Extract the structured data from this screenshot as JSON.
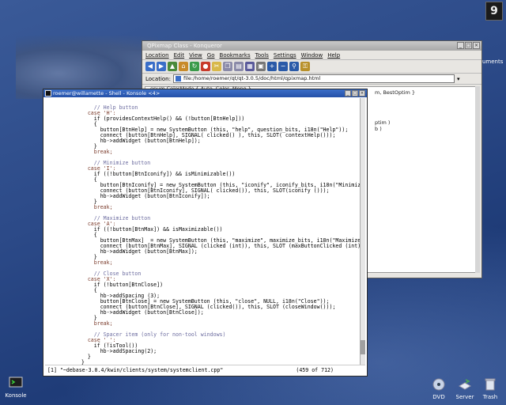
{
  "desktop": {
    "logo_text": "9",
    "icons": {
      "konsole": "Konsole",
      "dvd": "DVD",
      "server": "Server",
      "trash": "Trash",
      "edge": "uments"
    }
  },
  "konqueror": {
    "title": "QPixmap Class - Konqueror",
    "menu": [
      "Location",
      "Edit",
      "View",
      "Go",
      "Bookmarks",
      "Tools",
      "Settings",
      "Window",
      "Help"
    ],
    "location_label": "Location:",
    "location_value": "file:/home/roemer/qt/qt-3.0.5/doc/html/qpixmap.html",
    "content_lines": [
      "enum ColorMode { Auto, Color, Mono }",
      "m, BestOptim }",
      "ptim )",
      "b )"
    ]
  },
  "konsole": {
    "title": "roemer@willamette - Shell - Konsole <4>",
    "lines": [
      "        // Help button",
      "      case 'H':",
      "        if (providesContextHelp() && (!button[BtnHelp]))",
      "        {",
      "          button[BtnHelp] = new SystemButton (this, \"help\", question_bits, i18n(\"Help\"));",
      "          connect (button[BtnHelp], SIGNAL( clicked() ), this, SLOT( contextHelp()));",
      "          hb->addWidget (button[BtnHelp]);",
      "        }",
      "        break;",
      "",
      "        // Minimize button",
      "      case 'I':",
      "        if ((!button[BtnIconify]) && isMinimizable())",
      "        {",
      "          button[BtnIconify] = new SystemButton (this, \"iconify\", iconify_bits, i18n(\"Minimize\"));",
      "          connect (button[BtnIconify], SIGNAL( clicked()), this, SLOT(iconify ()));",
      "          hb->addWidget (button[BtnIconify]);",
      "        }",
      "        break;",
      "",
      "        // Maximize button",
      "      case 'A':",
      "        if ((!button[BtnMax]) && isMaximizable())",
      "        {",
      "          button[BtnMax]  = new SystemButton (this, \"maximize\", maximize_bits, i18n(\"Maximize\"));",
      "          connect (button[BtnMax], SIGNAL (clicked (int)), this, SLOT (maxButtonClicked (int)));",
      "          hb->addWidget (button[BtnMax]);",
      "        }",
      "        break;",
      "",
      "        // Close button",
      "      case 'X':",
      "        if (!button[BtnClose])",
      "        {",
      "          hb->addSpacing (3);",
      "          button[BtnClose] = new SystemButton (this, \"close\", NULL, i18n(\"Close\"));",
      "          connect (button[BtnClose], SIGNAL (clicked()), this, SLOT (closeWindow()));",
      "          hb->addWidget (button[BtnClose]);",
      "        }",
      "        break;",
      "",
      "        // Spacer item (only for non-tool windows)",
      "      case '_':",
      "        if (!isTool())",
      "          hb->addSpacing(2);",
      "      }",
      "    }",
      "}"
    ],
    "status_file": "[1] \"~debase-3.0.4/kwin/clients/system/systemclient.cpp\"",
    "status_pos": "(459 of 712)"
  }
}
